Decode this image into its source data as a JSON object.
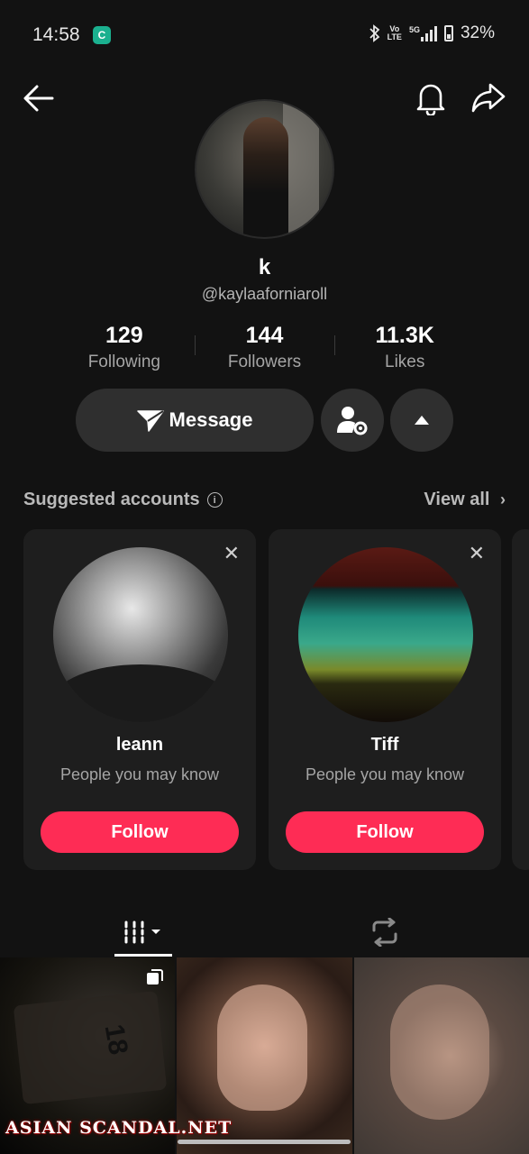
{
  "status_bar": {
    "time": "14:58",
    "app_badge": "C",
    "volte": "Vo\nLTE",
    "network": "5G",
    "battery": "32%"
  },
  "profile": {
    "display_name": "k",
    "handle": "@kaylaaforniaroll",
    "stats": [
      {
        "value": "129",
        "label": "Following"
      },
      {
        "value": "144",
        "label": "Followers"
      },
      {
        "value": "11.3K",
        "label": "Likes"
      }
    ],
    "message_label": "Message"
  },
  "suggested": {
    "title": "Suggested accounts",
    "view_all": "View all",
    "accounts": [
      {
        "name": "leann",
        "subtitle": "People you may know",
        "follow_label": "Follow"
      },
      {
        "name": "Tiff",
        "subtitle": "People you may know",
        "follow_label": "Follow"
      }
    ]
  },
  "watermark": "ASIAN SCANDAL.NET",
  "colors": {
    "accent": "#fe2c55",
    "background": "#121212",
    "card": "#1e1e1e",
    "button": "#2f2f2f"
  },
  "icons": [
    "back-arrow-icon",
    "bell-icon",
    "share-icon",
    "message-send-icon",
    "add-friend-settings-icon",
    "caret-up-icon",
    "info-icon",
    "chevron-right-icon",
    "close-icon",
    "video-grid-icon",
    "repost-icon",
    "multi-photo-icon"
  ]
}
